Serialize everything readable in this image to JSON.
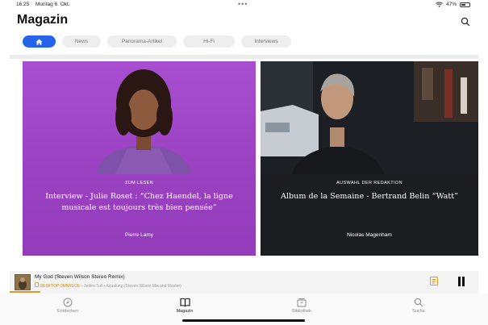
{
  "status_bar": {
    "time": "16:25",
    "date": "Montag 6. Okt.",
    "battery": "47%"
  },
  "header": {
    "title": "Magazin"
  },
  "tabs": [
    {
      "label": "",
      "icon": "home-icon",
      "active": true
    },
    {
      "label": "News"
    },
    {
      "label": "Panorama-Artikel"
    },
    {
      "label": "Hi-Fi"
    },
    {
      "label": "Interviews"
    }
  ],
  "cards": [
    {
      "kicker": "ZUM LESEN",
      "headline": "Interview - Julie Roset : “Chez Haendel, la ligne musicale est toujours très bien pensée”",
      "author": "Pierre Lamy",
      "background_color": "#9e45c6"
    },
    {
      "kicker": "AUSWAHL DER REDAKTION",
      "headline": "Album de la Semaine - Bertrand Belin  “Watt”",
      "author": "Nicolas Magenham",
      "background_color": "#1b1d21"
    }
  ],
  "player": {
    "title": "My God (Steven Wilson Stereo Remix)",
    "device": "DESKTOP-0MNRVOE",
    "artist_album": "Jethro Tull • Aqualung (Steven Wilson Mix and Master)",
    "progress": 0.065,
    "accent_color": "#d99a2b"
  },
  "nav": [
    {
      "label": "Entdecken",
      "icon": "compass-icon"
    },
    {
      "label": "Magazin",
      "icon": "book-icon",
      "active": true
    },
    {
      "label": "Bibliothek",
      "icon": "library-icon"
    },
    {
      "label": "Suche",
      "icon": "search-icon"
    }
  ]
}
